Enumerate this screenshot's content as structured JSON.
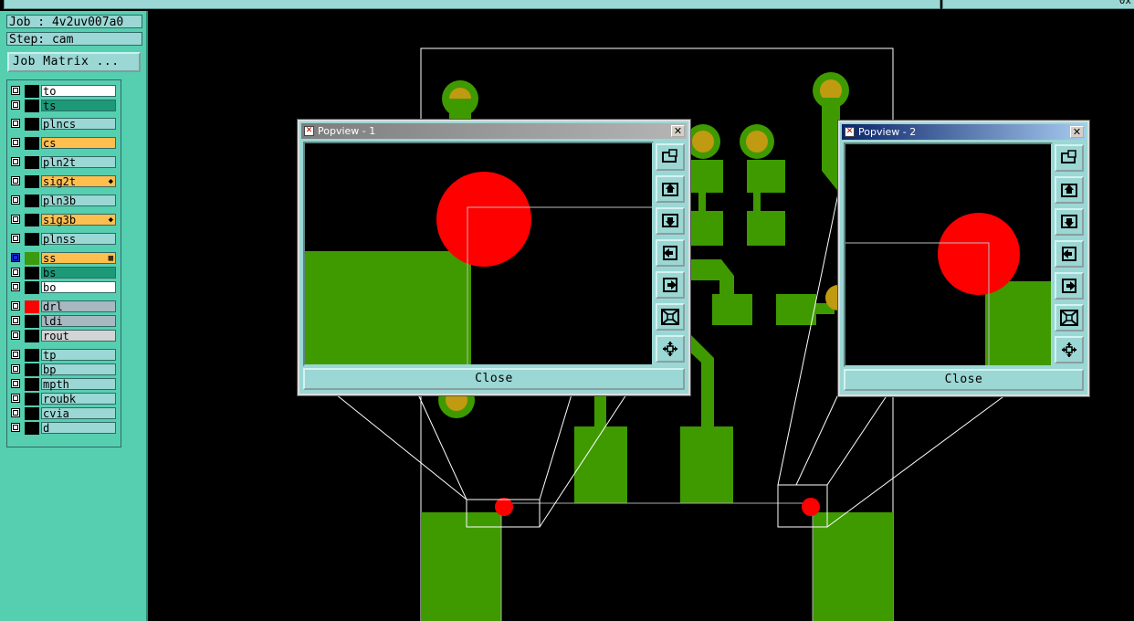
{
  "topbar": {
    "right_text": "0x"
  },
  "job": {
    "job_label": "Job : 4v2uv007a0",
    "step_label": "Step: cam",
    "matrix_button": "Job Matrix ..."
  },
  "layers": [
    {
      "name": "to",
      "color": "#000000",
      "bg": "#ffffff",
      "mark": ""
    },
    {
      "name": "ts",
      "color": "#000000",
      "bg": "#1c9a78",
      "mark": ""
    },
    {
      "name": "plncs",
      "color": "#000000",
      "bg": "#9bd7d4",
      "mark": ""
    },
    {
      "name": "cs",
      "color": "#000000",
      "bg": "#ffbf4f",
      "mark": ""
    },
    {
      "name": "pln2t",
      "color": "#000000",
      "bg": "#9bd7d4",
      "mark": ""
    },
    {
      "name": "sig2t",
      "color": "#000000",
      "bg": "#ffbf4f",
      "mark": "◆"
    },
    {
      "name": "pln3b",
      "color": "#000000",
      "bg": "#9bd7d4",
      "mark": ""
    },
    {
      "name": "sig3b",
      "color": "#000000",
      "bg": "#ffbf4f",
      "mark": "◆"
    },
    {
      "name": "plnss",
      "color": "#000000",
      "bg": "#9bd7d4",
      "mark": ""
    },
    {
      "name": "ss",
      "color": "#3a9a10",
      "bg": "#ffbf4f",
      "mark": "▦"
    },
    {
      "name": "bs",
      "color": "#000000",
      "bg": "#1c9a78",
      "mark": ""
    },
    {
      "name": "bo",
      "color": "#000000",
      "bg": "#ffffff",
      "mark": ""
    },
    {
      "name": "drl",
      "color": "#ff0000",
      "bg": "#a8b8c0",
      "mark": ""
    },
    {
      "name": "ldi",
      "color": "#000000",
      "bg": "#a8b8c0",
      "mark": ""
    },
    {
      "name": "rout",
      "color": "#000000",
      "bg": "#d4d4d4",
      "mark": ""
    },
    {
      "name": "tp",
      "color": "#000000",
      "bg": "#9bd7d4",
      "mark": ""
    },
    {
      "name": "bp",
      "color": "#000000",
      "bg": "#9bd7d4",
      "mark": ""
    },
    {
      "name": "mpth",
      "color": "#000000",
      "bg": "#9bd7d4",
      "mark": ""
    },
    {
      "name": "roubk",
      "color": "#000000",
      "bg": "#9bd7d4",
      "mark": ""
    },
    {
      "name": "cvia",
      "color": "#000000",
      "bg": "#9bd7d4",
      "mark": ""
    },
    {
      "name": "d",
      "color": "#000000",
      "bg": "#9bd7d4",
      "mark": ""
    }
  ],
  "popview1": {
    "title": "Popview - 1",
    "close_label": "Close",
    "close_x": "✕"
  },
  "popview2": {
    "title": "Popview - 2",
    "close_label": "Close",
    "close_x": "✕"
  },
  "colors": {
    "copper": "#3f9a00",
    "pad_ring": "#c09a10",
    "drill": "#ff0000",
    "panel": "#55cfb0",
    "widget": "#9bd7d4"
  },
  "tool_icons": [
    "zoom-home-icon",
    "pan-up-icon",
    "pan-down-icon",
    "pan-left-icon",
    "pan-right-icon",
    "zoom-in-icon",
    "zoom-out-icon"
  ]
}
